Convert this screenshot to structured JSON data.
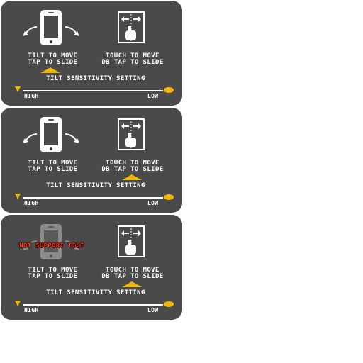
{
  "labels": {
    "tilt_line1": "TILT TO MOVE",
    "tilt_line2": "TAP TO SLIDE",
    "touch_line1": "TOUCH TO MOVE",
    "touch_line2": "DB TAP TO SLIDE",
    "sensitivity": "TILT SENSITIVITY SETTING",
    "high": "HIGH",
    "low": "LOW",
    "not_support": "NOT SUPPORT TILT"
  },
  "colors": {
    "panel": "#4a4a4a",
    "accent": "#f3b500",
    "warning": "#ff3b1f",
    "text": "#ffffff"
  },
  "icons": [
    "phone-tilt-icon",
    "tilt-left-arrow-icon",
    "tilt-right-arrow-icon",
    "touch-swipe-icon"
  ],
  "panels": [
    {
      "selected_mode": "tilt",
      "tilt_supported": true,
      "sensitivity": 0.0
    },
    {
      "selected_mode": "touch",
      "tilt_supported": true,
      "sensitivity": 0.0
    },
    {
      "selected_mode": "touch",
      "tilt_supported": false,
      "sensitivity": 0.0
    }
  ]
}
